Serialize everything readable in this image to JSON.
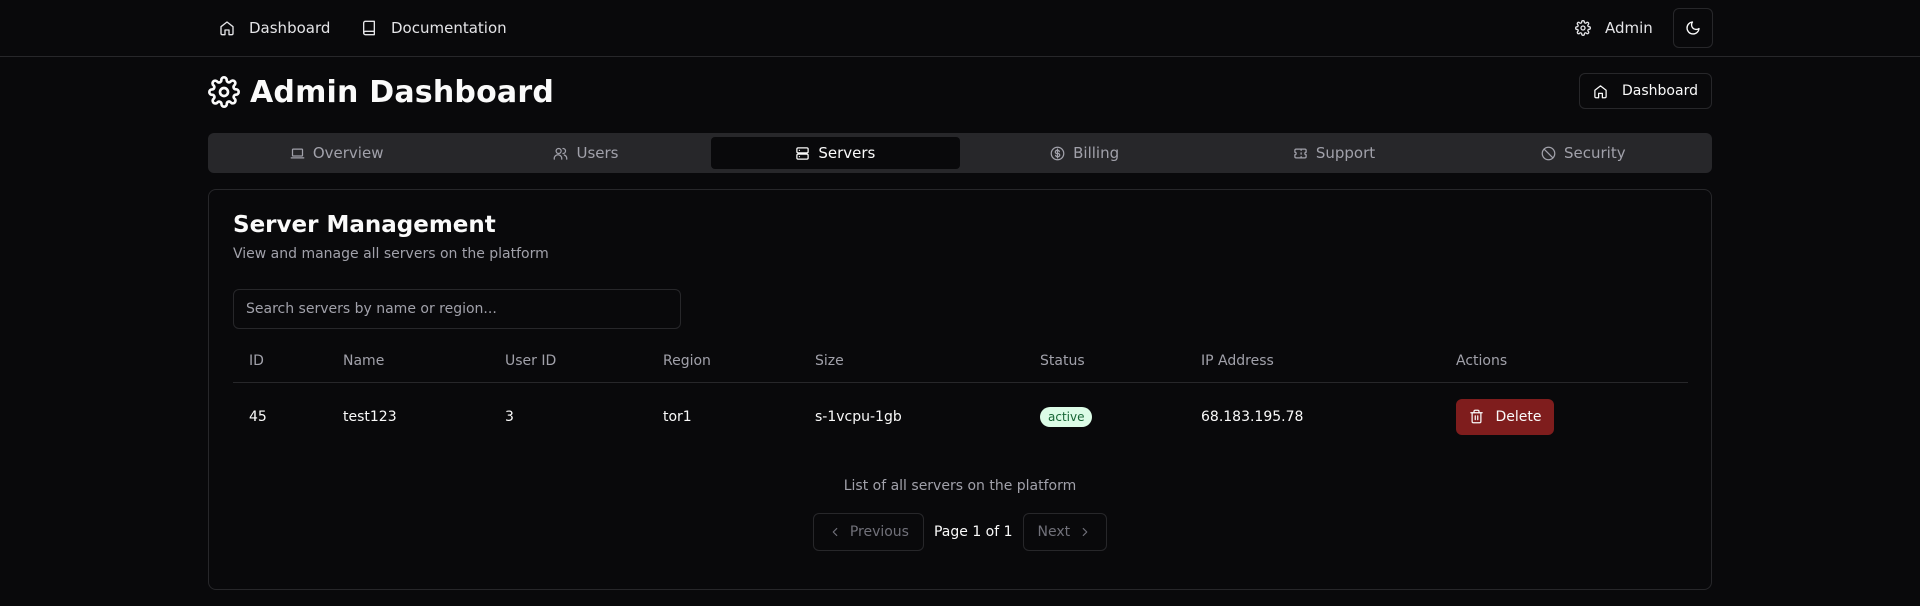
{
  "topnav": {
    "links": [
      {
        "label": "Dashboard",
        "icon": "home-icon"
      },
      {
        "label": "Documentation",
        "icon": "book-icon"
      }
    ],
    "user": {
      "label": "Admin",
      "icon": "gear-icon"
    },
    "theme_icon": "moon-icon"
  },
  "header": {
    "title": "Admin Dashboard",
    "icon": "gear-icon",
    "dashboard_button": "Dashboard"
  },
  "tabs": [
    {
      "label": "Overview",
      "icon": "laptop-icon",
      "active": false
    },
    {
      "label": "Users",
      "icon": "users-icon",
      "active": false
    },
    {
      "label": "Servers",
      "icon": "server-icon",
      "active": true
    },
    {
      "label": "Billing",
      "icon": "dollar-icon",
      "active": false
    },
    {
      "label": "Support",
      "icon": "ticket-icon",
      "active": false
    },
    {
      "label": "Security",
      "icon": "ban-icon",
      "active": false
    }
  ],
  "card": {
    "title": "Server Management",
    "description": "View and manage all servers on the platform",
    "search_placeholder": "Search servers by name or region...",
    "search_value": ""
  },
  "table": {
    "columns": [
      "ID",
      "Name",
      "User ID",
      "Region",
      "Size",
      "Status",
      "IP Address",
      "Actions"
    ],
    "rows": [
      {
        "id": "45",
        "name": "test123",
        "user_id": "3",
        "region": "tor1",
        "size": "s-1vcpu-1gb",
        "status": "active",
        "ip": "68.183.195.78",
        "action": "Delete"
      }
    ],
    "caption": "List of all servers on the platform"
  },
  "pagination": {
    "previous": "Previous",
    "info": "Page 1 of 1",
    "next": "Next"
  },
  "colors": {
    "background": "#09090b",
    "border": "#27272a",
    "muted_text": "#a1a1aa",
    "status_active_bg": "#dcfce7",
    "status_active_fg": "#166534",
    "delete_bg": "#7f1d1d"
  }
}
